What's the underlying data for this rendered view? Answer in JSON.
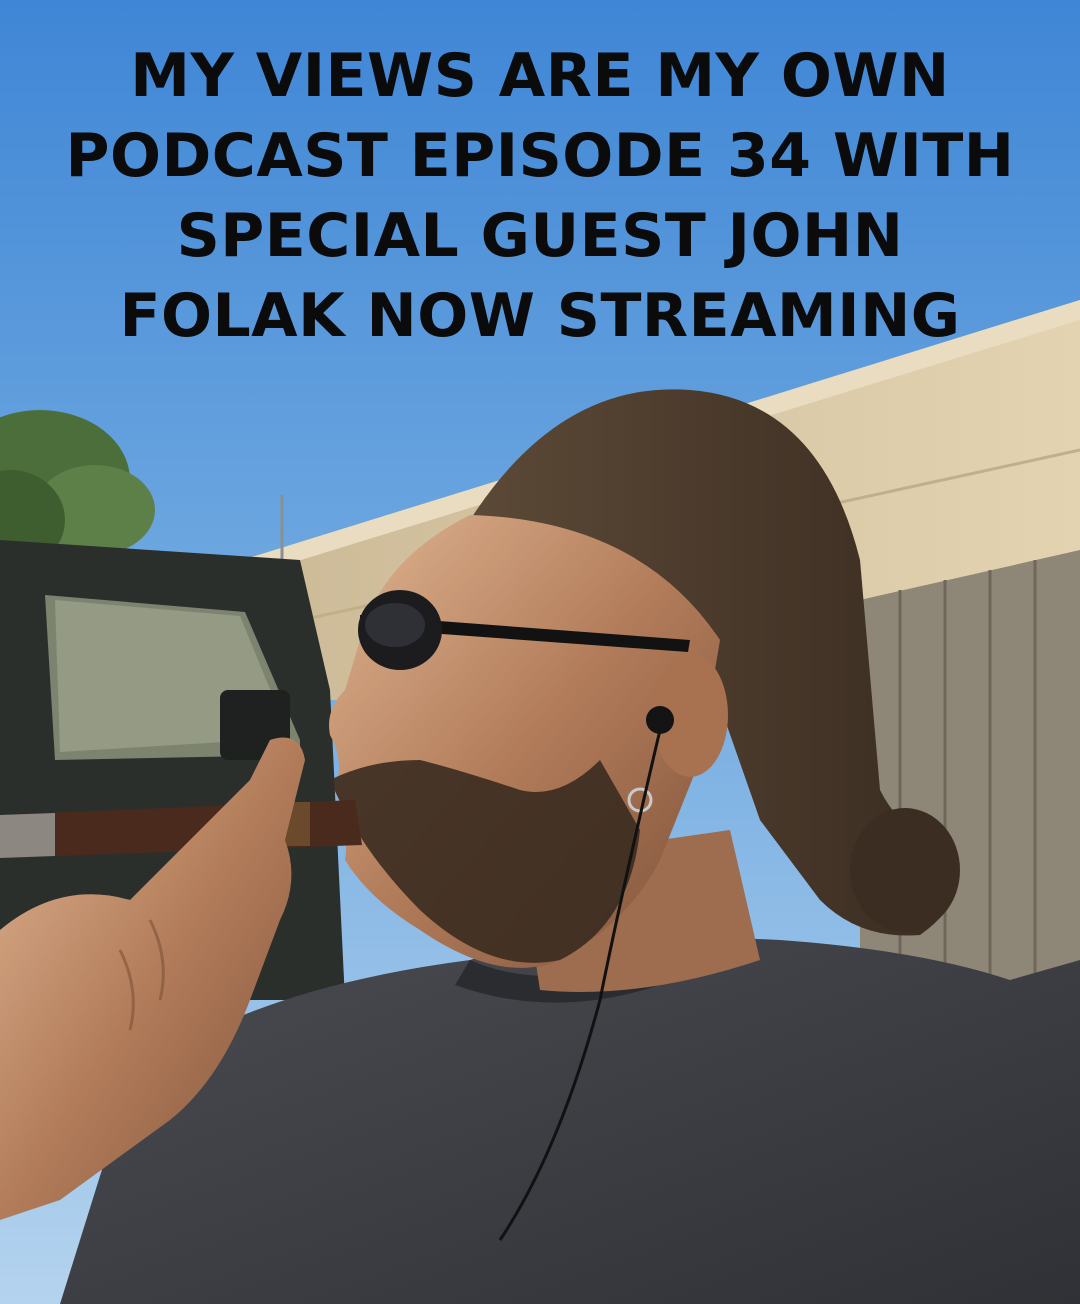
{
  "caption": {
    "lines": [
      "MY VIEWS ARE MY OWN",
      "PODCAST EPISODE 34 WITH",
      "SPECIAL GUEST JOHN",
      "FOLAK NOW STREAMING"
    ]
  },
  "colors": {
    "sky_top": "#3f86d6",
    "sky_bottom": "#a9cdec",
    "wall": "#d8c7a3",
    "fence": "#8d8576",
    "truck": "#2c302d",
    "shirt": "#3d3f44",
    "skin": "#b07a5a",
    "hair": "#4a3a2c",
    "cigar": "#4a2a1c",
    "caption_text": "#0b0b0b"
  }
}
